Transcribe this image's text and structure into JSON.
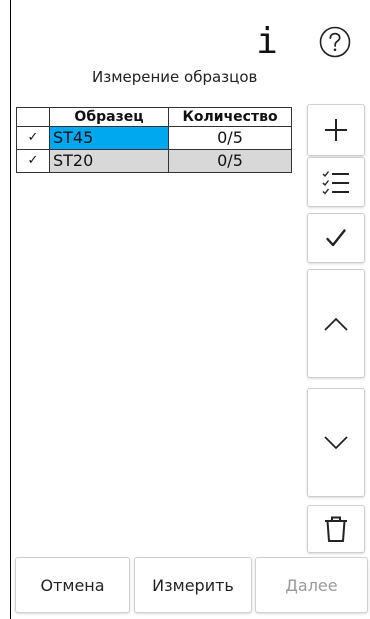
{
  "header": {
    "title": "Измерение образцов",
    "info_icon": "info-icon",
    "help_icon": "help-circle-icon"
  },
  "table": {
    "columns": [
      "",
      "Образец",
      "Количество"
    ],
    "rows": [
      {
        "check": "✓",
        "sample": "ST45",
        "quantity": "0/5",
        "selected": true
      },
      {
        "check": "✓",
        "sample": "ST20",
        "quantity": "0/5",
        "selected": false
      }
    ]
  },
  "toolbar": {
    "add_icon": "plus-icon",
    "list_icon": "checklist-icon",
    "check_icon": "checkmark-icon",
    "up_icon": "chevron-up-icon",
    "down_icon": "chevron-down-icon",
    "delete_icon": "trash-icon"
  },
  "footer": {
    "cancel": "Отмена",
    "measure": "Измерить",
    "next": "Далее"
  },
  "colors": {
    "selection": "#00a8f0",
    "row_gray": "#d8d8d8",
    "disabled_text": "#9a9a9a"
  }
}
